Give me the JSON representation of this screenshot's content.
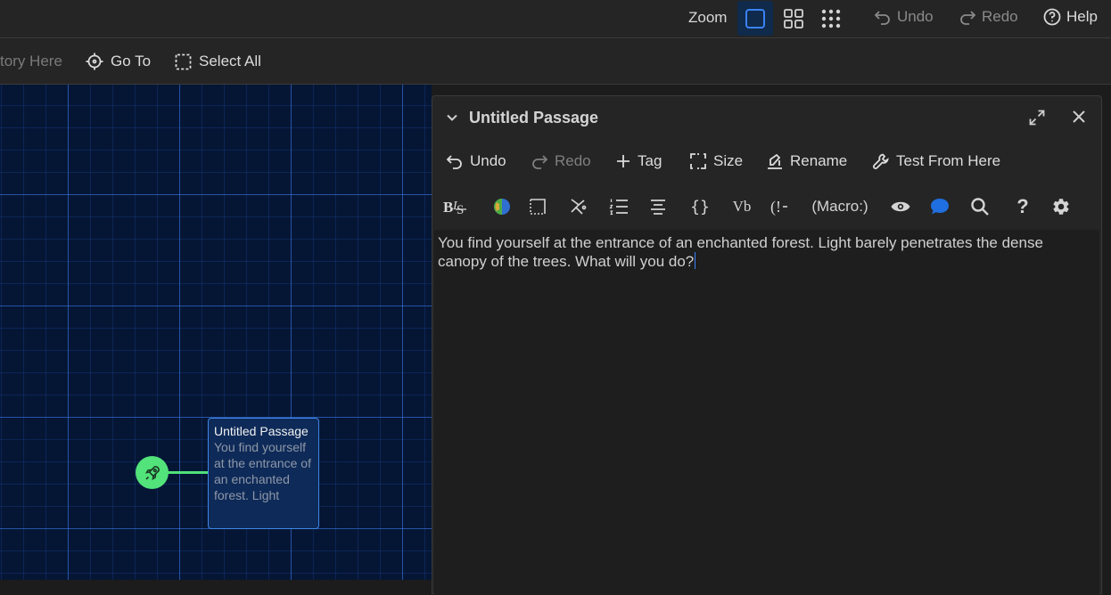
{
  "topbar": {
    "zoom_label": "Zoom",
    "undo_label": "Undo",
    "redo_label": "Redo",
    "help_label": "Help"
  },
  "subbar": {
    "story_label_partial": "tory Here",
    "goto_label": "Go To",
    "select_all_label": "Select All"
  },
  "canvas": {
    "passage_title": "Untitled Passage",
    "passage_excerpt": "You find yourself at the entrance of an enchanted forest. Light"
  },
  "panel": {
    "title": "Untitled Passage",
    "tools": {
      "undo": "Undo",
      "redo": "Redo",
      "tag": "Tag",
      "size": "Size",
      "rename": "Rename",
      "test": "Test From Here"
    },
    "format": {
      "macro": "(Macro:)",
      "vb": "Vb",
      "braces": "{}",
      "help": "?"
    },
    "body_text": "You find yourself at the entrance of an enchanted forest. Light barely penetrates the dense canopy of the trees. What will you do?"
  },
  "colors": {
    "accent": "#3b82f6",
    "start_green": "#52e37a",
    "canvas_bg": "#051635",
    "comment_blue": "#1f6fe0"
  }
}
